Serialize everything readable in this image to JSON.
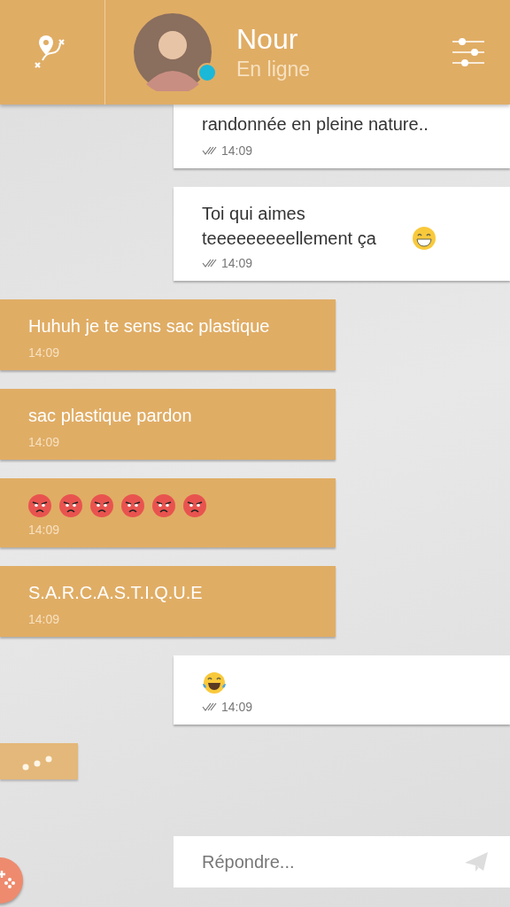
{
  "header": {
    "contact_name": "Nour",
    "status": "En ligne",
    "online": true
  },
  "messages": [
    {
      "kind": "sent",
      "text": "randonnée en pleine nature..",
      "time": "14:09",
      "read": true,
      "cut_top": true
    },
    {
      "kind": "sent",
      "text": "Toi qui aimes teeeeeeeeellement ça",
      "emojis": [
        {
          "kind": "grin"
        }
      ],
      "time": "14:09",
      "read": true
    },
    {
      "kind": "received",
      "text": "Huhuh je te sens sac plastique",
      "time": "14:09"
    },
    {
      "kind": "received",
      "text": "sac plastique pardon",
      "time": "14:09"
    },
    {
      "kind": "received",
      "emojis": [
        {
          "kind": "angry"
        },
        {
          "kind": "angry"
        },
        {
          "kind": "angry"
        },
        {
          "kind": "angry"
        },
        {
          "kind": "angry"
        },
        {
          "kind": "angry"
        }
      ],
      "time": "14:09"
    },
    {
      "kind": "received",
      "text": "S.A.R.C.A.S.T.I.Q.U.E",
      "time": "14:09"
    },
    {
      "kind": "sent",
      "emojis": [
        {
          "kind": "laugh"
        }
      ],
      "time": "14:09",
      "read": true
    }
  ],
  "typing": true,
  "reply": {
    "placeholder": "Répondre..."
  }
}
